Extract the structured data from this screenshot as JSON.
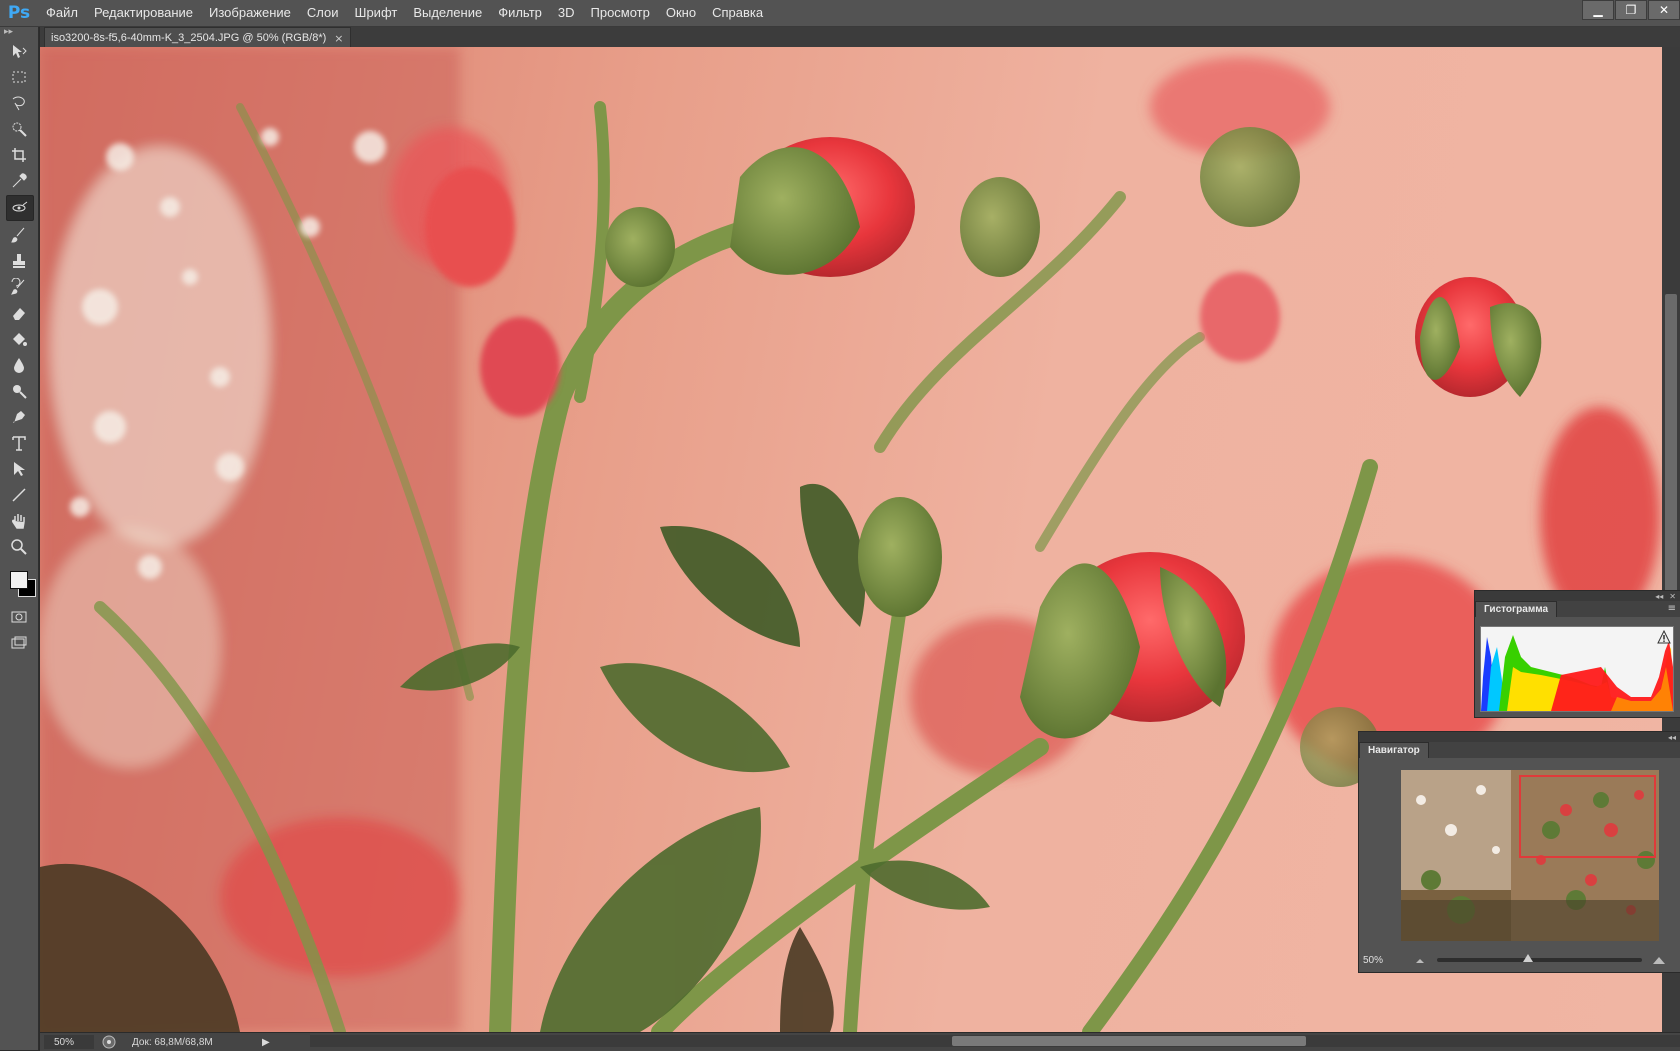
{
  "app": {
    "logo": "Ps"
  },
  "menu": [
    "Файл",
    "Редактирование",
    "Изображение",
    "Слои",
    "Шрифт",
    "Выделение",
    "Фильтр",
    "3D",
    "Просмотр",
    "Окно",
    "Справка"
  ],
  "window_controls": {
    "minimize": "▁",
    "restore": "❐",
    "close": "✕"
  },
  "document_tab": {
    "title": "iso3200-8s-f5,6-40mm-K_3_2504.JPG @ 50% (RGB/8*)",
    "close": "×"
  },
  "tools": [
    "move-icon",
    "marquee-icon",
    "lasso-icon",
    "quick-select-icon",
    "crop-icon",
    "eyedropper-icon",
    "spot-heal-icon",
    "brush-icon",
    "stamp-icon",
    "history-brush-icon",
    "eraser-icon",
    "paint-bucket-icon",
    "blur-icon",
    "dodge-icon",
    "pen-icon",
    "type-icon",
    "path-select-icon",
    "line-icon",
    "hand-icon",
    "zoom-icon"
  ],
  "colors": {
    "foreground": "#f2f2f2",
    "background": "#000000",
    "accent": "#3fa9f5"
  },
  "status": {
    "zoom": "50%",
    "doc_size": "Док: 68,8M/68,8M",
    "arrow": "▶"
  },
  "histogram_panel": {
    "tab": "Гистограмма",
    "menu": "≡",
    "collapse": "◂◂",
    "close": "✕"
  },
  "navigator_panel": {
    "tab": "Навигатор",
    "zoom": "50%",
    "collapse": "◂◂",
    "zoom_level_fraction": 0.42
  }
}
